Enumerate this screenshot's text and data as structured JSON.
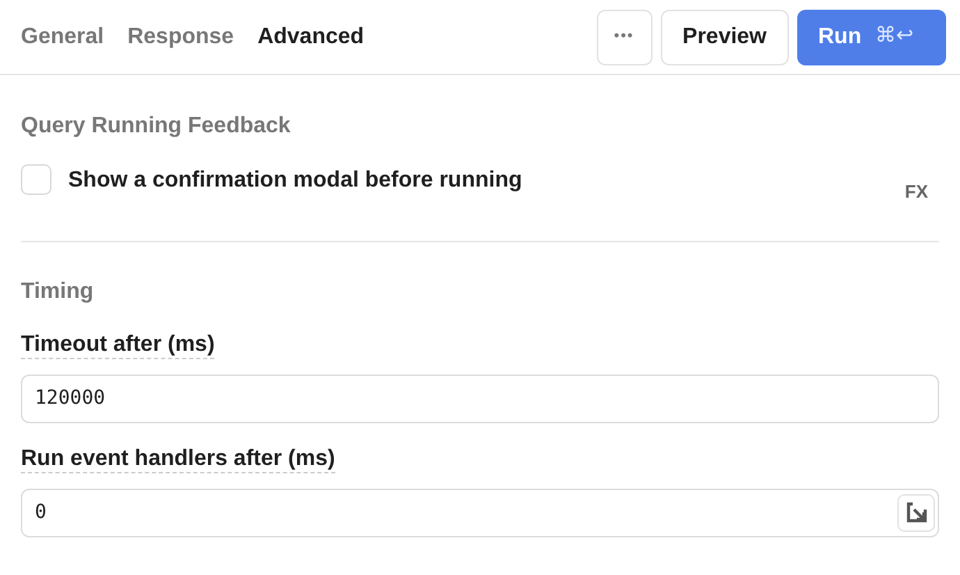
{
  "tabs": [
    {
      "label": "General",
      "selected": false
    },
    {
      "label": "Response",
      "selected": false
    },
    {
      "label": "Advanced",
      "selected": true
    }
  ],
  "toolbar": {
    "more": "•••",
    "preview": "Preview",
    "run": "Run",
    "run_shortcut": "⌘↩"
  },
  "sections": [
    {
      "title": "Query Running Feedback",
      "checkbox": {
        "label": "Show a confirmation modal before running",
        "checked": false
      },
      "fx": "FX"
    },
    {
      "title": "Timing",
      "fields": [
        {
          "label": "Timeout after (ms)",
          "value": "120000",
          "has_action": false
        },
        {
          "label": "Run event handlers after (ms)",
          "value": "0",
          "has_action": true
        }
      ]
    }
  ]
}
